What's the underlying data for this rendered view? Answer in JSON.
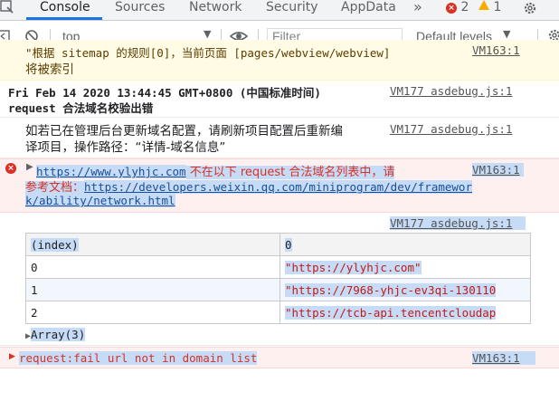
{
  "tabs": {
    "console": "Console",
    "sources": "Sources",
    "network": "Network",
    "security": "Security",
    "appdata": "AppData",
    "more": "»"
  },
  "counts": {
    "errors": "2",
    "warnings": "1"
  },
  "toolbar": {
    "context": "top",
    "filter_placeholder": "Filter",
    "levels": "Default levels"
  },
  "messages": {
    "partial_top_line1": "\"根据 sitemap 的规则[0]，当前页面 [pages/webview/webview]",
    "partial_top_line2": "将被索引",
    "partial_top_source": "VM163:1",
    "ts_header": "Fri Feb 14 2020 13:44:45 GMT+0800 (中国标准时间)",
    "ts_sub": "request 合法域名校验出错",
    "ts_source": "VM177 asdebug.js:1",
    "info_line1": "如若已在管理后台更新域名配置，请刷新项目配置后重新编",
    "info_line2": "译项目，操作路径：“详情-域名信息”",
    "info_source": "VM177 asdebug.js:1",
    "err_url": "https://www.ylyhjc.com",
    "err_text": " 不在以下 request 合法域名列表中，请",
    "err_line2_prefix": "参考文档：",
    "err_doc_line1": "https://developers.weixin.qq.com/miniprogram/dev/framewor",
    "err_doc_line2": "k/ability/network.html",
    "err_source": "VM163:1",
    "table_source": "VM177 asdebug.js:1",
    "array_label": "Array(3)",
    "fail_text": "request:fail url not in domain list",
    "fail_source": "VM163:1"
  },
  "table": {
    "headers": [
      "(index)",
      "0"
    ],
    "rows": [
      {
        "index": "0",
        "value": "\"https://ylyhjc.com\""
      },
      {
        "index": "1",
        "value": "\"https://7968-yhjc-ev3qi-130110"
      },
      {
        "index": "2",
        "value": "\"https://tcb-api.tencentcloudap"
      }
    ]
  },
  "colors": {
    "accent": "#1a73e8",
    "error": "#d93025",
    "error_bg": "#fff0f0",
    "warning_bg": "#fffbe5",
    "selection": "#c6dbf6"
  }
}
